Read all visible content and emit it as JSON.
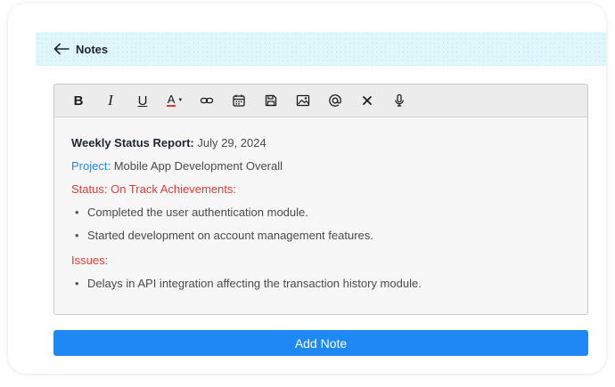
{
  "header": {
    "title": "Notes"
  },
  "toolbar": {
    "bold_label": "B",
    "italic_label": "I",
    "underline_label": "U",
    "text_color_label": "A",
    "text_color": "#e53935",
    "icons": [
      "link-icon",
      "calendar-icon",
      "save-icon",
      "image-icon",
      "mention-icon",
      "clear-icon",
      "microphone-icon"
    ]
  },
  "note": {
    "report_label": "Weekly Status Report:",
    "report_date": " July 29, 2024",
    "project_label": "Project:",
    "project_value": " Mobile App Development Overall",
    "status_line": "Status: On Track Achievements:",
    "achievements": [
      "Completed the user authentication module.",
      "Started development on account management features."
    ],
    "issues_label": "Issues:",
    "issues": [
      "Delays in API integration affecting the transaction history module."
    ]
  },
  "actions": {
    "add_note_label": "Add Note"
  },
  "colors": {
    "accent": "#1e88f5",
    "header_bg": "#dff7fb",
    "status_red": "#e53935",
    "project_blue": "#1e88e5"
  }
}
